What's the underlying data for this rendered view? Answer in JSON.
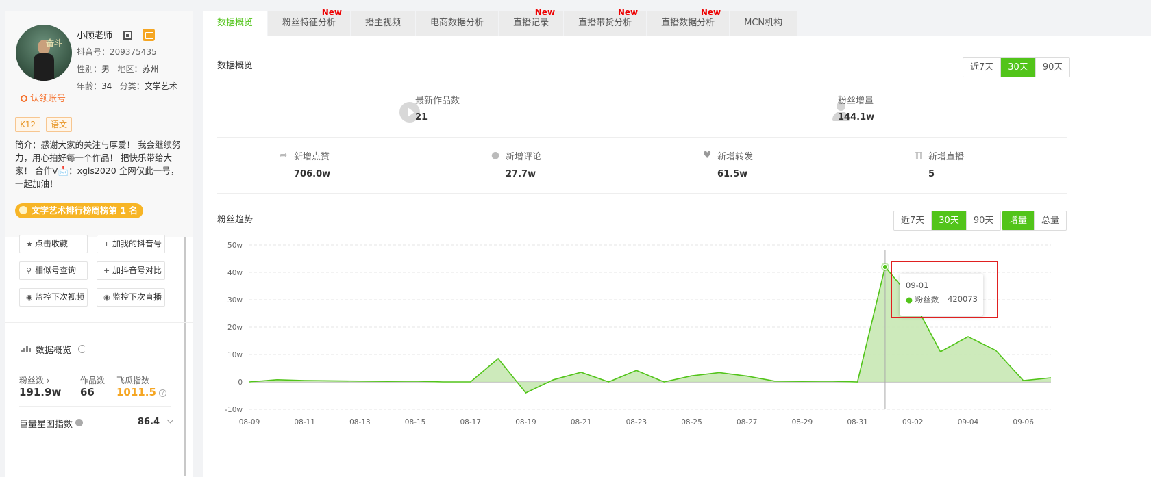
{
  "profile": {
    "name": "小顾老师",
    "avatar_text": "奋斗",
    "douyin_id": "抖音号：209375435",
    "gender_label": "性别：",
    "gender": "男",
    "region_label": "地区：",
    "region": "苏州",
    "age_label": "年龄：",
    "age": "34",
    "category_label": "分类：",
    "category": "文学艺术",
    "claim": "认领账号",
    "tags": [
      "K12",
      "语文"
    ],
    "bio": "简介：感谢大家的关注与厚爱！ 我会继续努力，用心拍好每一个作品！ 把快乐带给大家！ 合作V📩：xgls2020 全网仅此一号，一起加油！",
    "rank": "文学艺术排行榜周榜第 1 名"
  },
  "actions": [
    "点击收藏",
    "加我的抖音号",
    "相似号查询",
    "加抖音号对比",
    "监控下次视频",
    "监控下次直播"
  ],
  "side_overview": {
    "title": "数据概览",
    "fans_label": "粉丝数",
    "fans": "191.9w",
    "works_label": "作品数",
    "works": "66",
    "index_label": "飞瓜指数",
    "index": "1011.5",
    "juliang_label": "巨量星图指数",
    "juliang": "86.4"
  },
  "tabs": [
    {
      "label": "数据概览",
      "new": ""
    },
    {
      "label": "粉丝特征分析",
      "new": "New"
    },
    {
      "label": "播主视频",
      "new": ""
    },
    {
      "label": "电商数据分析",
      "new": ""
    },
    {
      "label": "直播记录",
      "new": "New"
    },
    {
      "label": "直播带货分析",
      "new": "New"
    },
    {
      "label": "直播数据分析",
      "new": "New"
    },
    {
      "label": "MCN机构",
      "new": ""
    }
  ],
  "overview": {
    "title": "数据概览",
    "ranges": [
      "近7天",
      "30天",
      "90天"
    ],
    "latest_works_label": "最新作品数",
    "latest_works": "21",
    "fans_inc_label": "粉丝增量",
    "fans_inc": "144.1w",
    "likes_label": "新增点赞",
    "likes": "706.0w",
    "comments_label": "新增评论",
    "comments": "27.7w",
    "shares_label": "新增转发",
    "shares": "61.5w",
    "live_label": "新增直播",
    "live": "5"
  },
  "trend": {
    "title": "粉丝趋势",
    "ranges": [
      "近7天",
      "30天",
      "90天"
    ],
    "modes": [
      "增量",
      "总量"
    ],
    "tooltip_date": "09-01",
    "tooltip_series": "粉丝数",
    "tooltip_value": "420073"
  },
  "colors": {
    "accent": "#52c41a",
    "area": "#c8e8b4",
    "highlight": "#e02020"
  },
  "chart_data": {
    "type": "area",
    "x": [
      "08-09",
      "08-10",
      "08-11",
      "08-12",
      "08-13",
      "08-14",
      "08-15",
      "08-16",
      "08-17",
      "08-18",
      "08-19",
      "08-20",
      "08-21",
      "08-22",
      "08-23",
      "08-24",
      "08-25",
      "08-26",
      "08-27",
      "08-28",
      "08-29",
      "08-30",
      "08-31",
      "09-01",
      "09-02",
      "09-03",
      "09-04",
      "09-05",
      "09-06",
      "09-07"
    ],
    "x_ticks": [
      "08-09",
      "08-11",
      "08-13",
      "08-15",
      "08-17",
      "08-19",
      "08-21",
      "08-23",
      "08-25",
      "08-27",
      "08-29",
      "08-31",
      "09-02",
      "09-04",
      "09-06"
    ],
    "series": [
      {
        "values": [
          0,
          8000,
          5000,
          4000,
          3000,
          2000,
          3000,
          0,
          0,
          85000,
          -40000,
          8000,
          35000,
          0,
          42000,
          0,
          22000,
          34000,
          21000,
          3000,
          2000,
          3000,
          0,
          420073,
          300000,
          110000,
          165000,
          115000,
          5000,
          15000
        ]
      }
    ],
    "yticks": [
      "50w",
      "40w",
      "30w",
      "20w",
      "10w",
      "0",
      "-10w"
    ],
    "ylim": [
      -100000,
      500000
    ],
    "grid": true,
    "highlight_index": 23
  }
}
